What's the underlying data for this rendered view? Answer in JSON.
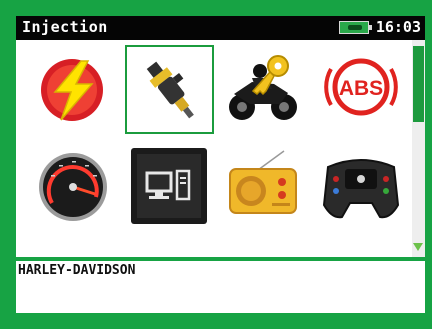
{
  "header": {
    "title": "Injection",
    "time": "16:03",
    "battery_icon": "battery-charging-icon"
  },
  "menu": {
    "items": [
      {
        "icon": "lightning-bolt-icon",
        "selected": false
      },
      {
        "icon": "fuel-injector-icon",
        "selected": true
      },
      {
        "icon": "motorbike-key-icon",
        "selected": false
      },
      {
        "icon": "abs-icon",
        "selected": false
      },
      {
        "icon": "speedometer-icon",
        "selected": false
      },
      {
        "icon": "computer-icon",
        "selected": false
      },
      {
        "icon": "radio-icon",
        "selected": false
      },
      {
        "icon": "steering-wheel-icon",
        "selected": false
      }
    ],
    "abs_label": "ABS"
  },
  "info": {
    "text": "HARLEY-DAVIDSON"
  },
  "colors": {
    "frame": "#17a344",
    "titlebar": "#050505",
    "selection": "#1b9c3d"
  }
}
